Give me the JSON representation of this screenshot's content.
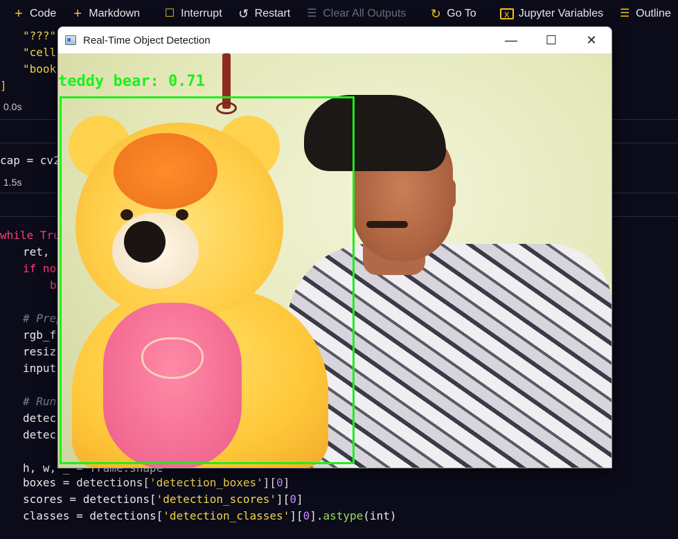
{
  "toolbar": {
    "items": [
      {
        "icon": "plus-icon",
        "label": "Code"
      },
      {
        "icon": "plus-icon",
        "label": "Markdown"
      },
      {
        "icon": "stop-icon",
        "label": "Interrupt"
      },
      {
        "icon": "restart-icon",
        "label": "Restart"
      },
      {
        "icon": "clear-outputs-icon",
        "label": "Clear All Outputs"
      },
      {
        "icon": "goto-icon",
        "label": "Go To"
      },
      {
        "icon": "variables-icon",
        "label": "Jupyter Variables"
      },
      {
        "icon": "outline-icon",
        "label": "Outline"
      },
      {
        "icon": "more-icon",
        "label": "···"
      }
    ]
  },
  "notebook": {
    "cell1_lines": [
      "\"???\"",
      "\"cell",
      "\"book"
    ],
    "cell1_bracket": "]",
    "cell1_time": "0.0s",
    "cell2_line": "cap = cv2",
    "cell2_time": "1.5s",
    "cell3_lines": {
      "while": "while",
      "true": " Tru",
      "ret": "ret, ",
      "ifno": "if no",
      "b": "b",
      "comment_prep": "# Prep",
      "rgb": "rgb_f",
      "resiz": "resiz",
      "input": "input",
      "comment_run": "# Run",
      "detec1": "detec",
      "detec2": "detec",
      "hw": "h, w, _ = frame.shape",
      "boxes_var": "boxes",
      "boxes_eq": " = detections[",
      "boxes_key": "'detection_boxes'",
      "boxes_idx": "][",
      "boxes_num": "0",
      "boxes_end": "]",
      "scores_var": "scores",
      "scores_eq": " = detections[",
      "scores_key": "'detection_scores'",
      "scores_idx": "][",
      "scores_num": "0",
      "scores_end": "]",
      "classes_var": "classes",
      "classes_eq": " = detections[",
      "classes_key": "'detection_classes'",
      "classes_idx": "][",
      "classes_num": "0",
      "classes_mid": "].",
      "classes_fn": "astype",
      "classes_arg": "(int)"
    }
  },
  "window": {
    "title": "Real-Time Object Detection",
    "minimize": "—",
    "maximize": "☐",
    "close": "✕",
    "detection": {
      "label": "teddy bear: 0.71",
      "box_color": "#1cf01c"
    }
  }
}
